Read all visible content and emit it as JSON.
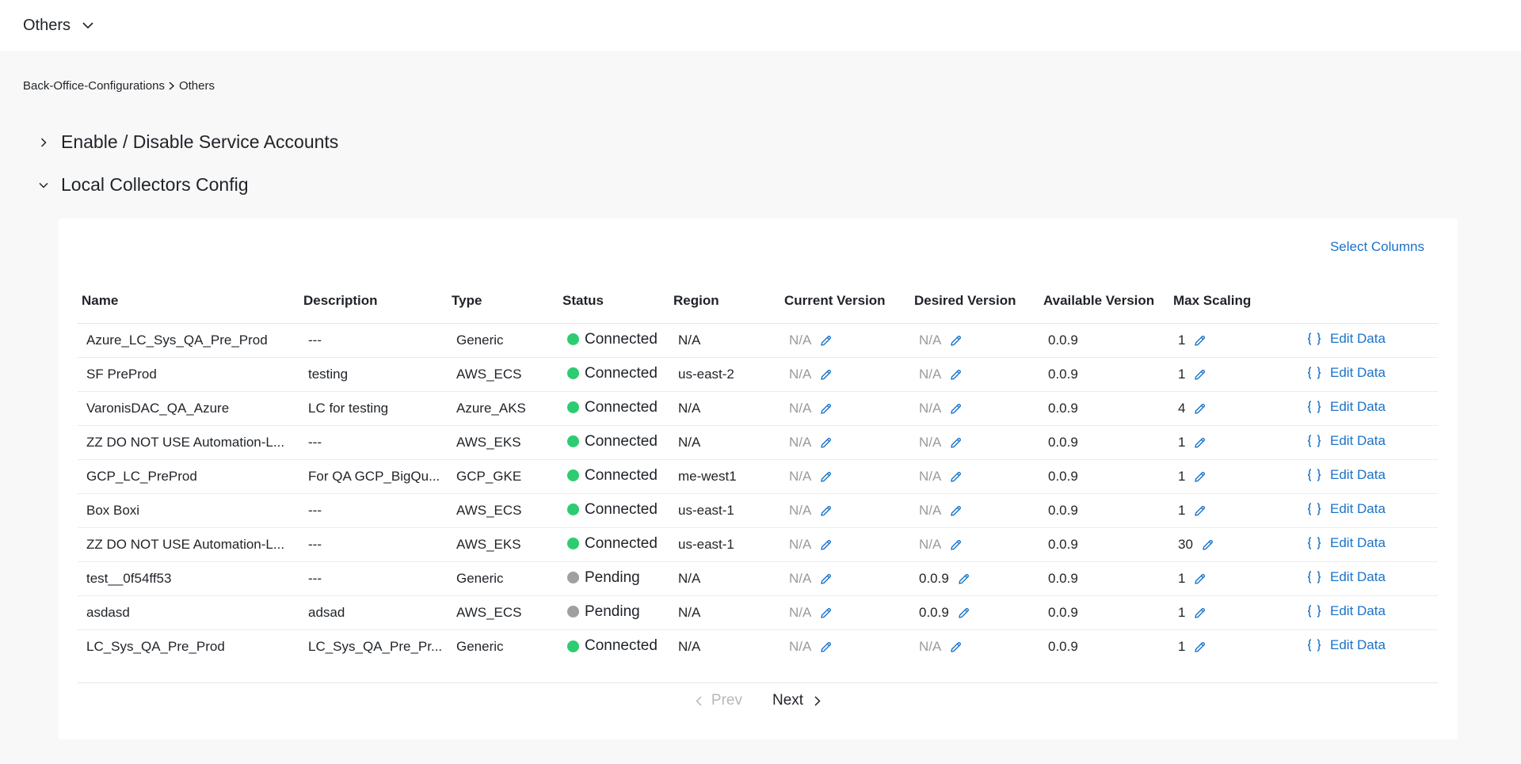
{
  "header": {
    "title": "Others"
  },
  "breadcrumb": {
    "parent": "Back-Office-Configurations",
    "current": "Others"
  },
  "sections": [
    {
      "label": "Enable / Disable Service Accounts",
      "expanded": false
    },
    {
      "label": "Local Collectors Config",
      "expanded": true
    }
  ],
  "table": {
    "select_columns_label": "Select Columns",
    "columns": [
      "Name",
      "Description",
      "Type",
      "Status",
      "Region",
      "Current Version",
      "Desired Version",
      "Available Version",
      "Max Scaling"
    ],
    "edit_label": "Edit Data",
    "rows": [
      {
        "name": "Azure_LC_Sys_QA_Pre_Prod",
        "description": "---",
        "type": "Generic",
        "status": "Connected",
        "region": "N/A",
        "current": "N/A",
        "desired": "N/A",
        "available": "0.0.9",
        "max": "1"
      },
      {
        "name": "SF PreProd",
        "description": "testing",
        "type": "AWS_ECS",
        "status": "Connected",
        "region": "us-east-2",
        "current": "N/A",
        "desired": "N/A",
        "available": "0.0.9",
        "max": "1"
      },
      {
        "name": "VaronisDAC_QA_Azure",
        "description": "LC for testing",
        "type": "Azure_AKS",
        "status": "Connected",
        "region": "N/A",
        "current": "N/A",
        "desired": "N/A",
        "available": "0.0.9",
        "max": "4"
      },
      {
        "name": "ZZ DO NOT USE Automation-L...",
        "description": "---",
        "type": "AWS_EKS",
        "status": "Connected",
        "region": "N/A",
        "current": "N/A",
        "desired": "N/A",
        "available": "0.0.9",
        "max": "1"
      },
      {
        "name": "GCP_LC_PreProd",
        "description": "For QA GCP_BigQu...",
        "type": "GCP_GKE",
        "status": "Connected",
        "region": "me-west1",
        "current": "N/A",
        "desired": "N/A",
        "available": "0.0.9",
        "max": "1"
      },
      {
        "name": "Box Boxi",
        "description": "---",
        "type": "AWS_ECS",
        "status": "Connected",
        "region": "us-east-1",
        "current": "N/A",
        "desired": "N/A",
        "available": "0.0.9",
        "max": "1"
      },
      {
        "name": "ZZ DO NOT USE Automation-L...",
        "description": "---",
        "type": "AWS_EKS",
        "status": "Connected",
        "region": "us-east-1",
        "current": "N/A",
        "desired": "N/A",
        "available": "0.0.9",
        "max": "30"
      },
      {
        "name": "test__0f54ff53",
        "description": "---",
        "type": "Generic",
        "status": "Pending",
        "region": "N/A",
        "current": "N/A",
        "desired": "0.0.9",
        "available": "0.0.9",
        "max": "1"
      },
      {
        "name": "asdasd",
        "description": "adsad",
        "type": "AWS_ECS",
        "status": "Pending",
        "region": "N/A",
        "current": "N/A",
        "desired": "0.0.9",
        "available": "0.0.9",
        "max": "1"
      },
      {
        "name": "LC_Sys_QA_Pre_Prod",
        "description": "LC_Sys_QA_Pre_Pr...",
        "type": "Generic",
        "status": "Connected",
        "region": "N/A",
        "current": "N/A",
        "desired": "N/A",
        "available": "0.0.9",
        "max": "1"
      }
    ]
  },
  "pagination": {
    "prev_label": "Prev",
    "next_label": "Next"
  },
  "colors": {
    "accent": "#1a73c8",
    "connected": "#2ecc71",
    "pending": "#a0a0a0",
    "muted": "#9a9a9a"
  },
  "icons": {
    "dropdown": "chevron-down-icon",
    "crumb": "chevron-right-icon",
    "edit": "pencil-icon",
    "edit_data": "braces-icon"
  }
}
